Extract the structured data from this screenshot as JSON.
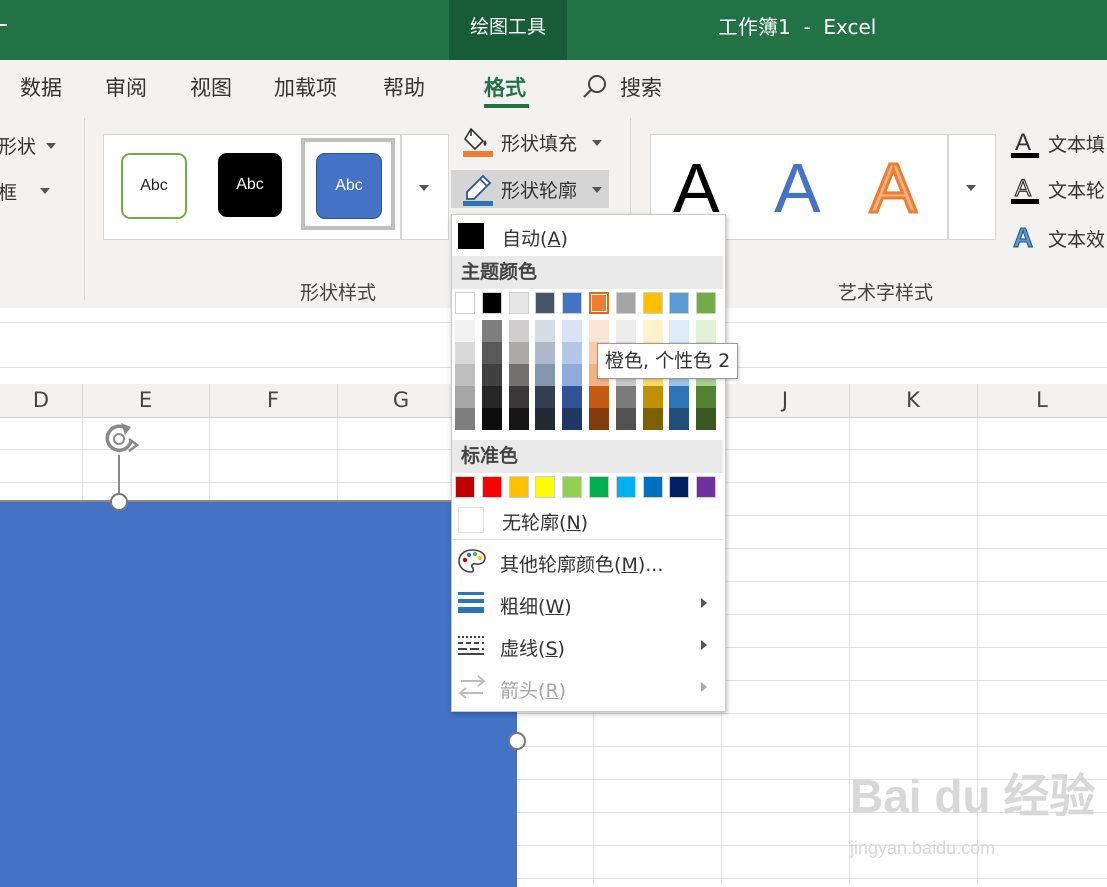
{
  "title_bar": {
    "context_tab": "绘图工具",
    "document_title": "工作簿1  -  Excel",
    "background_color": "#217346"
  },
  "ribbon": {
    "tabs": [
      "数据",
      "审阅",
      "视图",
      "加载项",
      "帮助",
      "格式",
      "搜索"
    ],
    "active_tab": "格式",
    "left_cut_items": [
      "形状",
      "框"
    ],
    "shape_styles": {
      "samples": [
        "Abc",
        "Abc",
        "Abc"
      ],
      "group_label": "形状样式"
    },
    "fill_button": "形状填充",
    "outline_button": "形状轮廓",
    "wordart": {
      "samples": [
        "A",
        "A",
        "A"
      ],
      "group_label": "艺术字样式",
      "buttons": [
        "文本填",
        "文本轮",
        "文本效"
      ]
    }
  },
  "columns": [
    "D",
    "E",
    "F",
    "G",
    "J",
    "K",
    "L"
  ],
  "outline_menu": {
    "auto": {
      "label": "自动",
      "accel": "A"
    },
    "theme_header": "主题颜色",
    "theme_colors": [
      [
        "#ffffff",
        "#000000",
        "#e7e6e6",
        "#44546a",
        "#4472c4",
        "#ed7d31",
        "#a5a5a5",
        "#ffc000",
        "#5b9bd5",
        "#70ad47"
      ],
      [
        "#f2f2f2",
        "#7f7f7f",
        "#d0cece",
        "#d6dce4",
        "#dae3f3",
        "#fbe5d6",
        "#ededed",
        "#fff2cc",
        "#deebf7",
        "#e2f0d9"
      ],
      [
        "#d9d9d9",
        "#595959",
        "#aeaaaa",
        "#adb9ca",
        "#b4c7e7",
        "#f8cbad",
        "#dbdbdb",
        "#ffe699",
        "#bdd7ee",
        "#c5e0b4"
      ],
      [
        "#bfbfbf",
        "#404040",
        "#757171",
        "#8497b0",
        "#8faadc",
        "#f4b183",
        "#c9c9c9",
        "#ffd966",
        "#9dc3e6",
        "#a9d18e"
      ],
      [
        "#a6a6a6",
        "#262626",
        "#3a3838",
        "#333f50",
        "#2f5597",
        "#c55a11",
        "#7b7b7b",
        "#bf9000",
        "#2e75b6",
        "#548235"
      ],
      [
        "#7f7f7f",
        "#0d0d0d",
        "#171616",
        "#222a35",
        "#1f3864",
        "#843c0c",
        "#525252",
        "#7f6000",
        "#1f4e79",
        "#385723"
      ]
    ],
    "standard_header": "标准色",
    "standard_colors": [
      "#c00000",
      "#ff0000",
      "#ffc000",
      "#ffff00",
      "#92d050",
      "#00b050",
      "#00b0f0",
      "#0070c0",
      "#002060",
      "#7030a0"
    ],
    "no_outline": {
      "label": "无轮廓",
      "accel": "N"
    },
    "more_colors": {
      "label": "其他轮廓颜色",
      "accel": "M",
      "suffix": "..."
    },
    "weight": {
      "label": "粗细",
      "accel": "W"
    },
    "dashes": {
      "label": "虚线",
      "accel": "S"
    },
    "arrows": {
      "label": "箭头",
      "accel": "R"
    },
    "tooltip": "橙色, 个性色 2",
    "highlighted_swatch": "#ed7d31"
  },
  "shape_fill_color": "#4472c4",
  "watermark": {
    "logo": "Bai du 经验",
    "url": "jingyan.baidu.com"
  }
}
